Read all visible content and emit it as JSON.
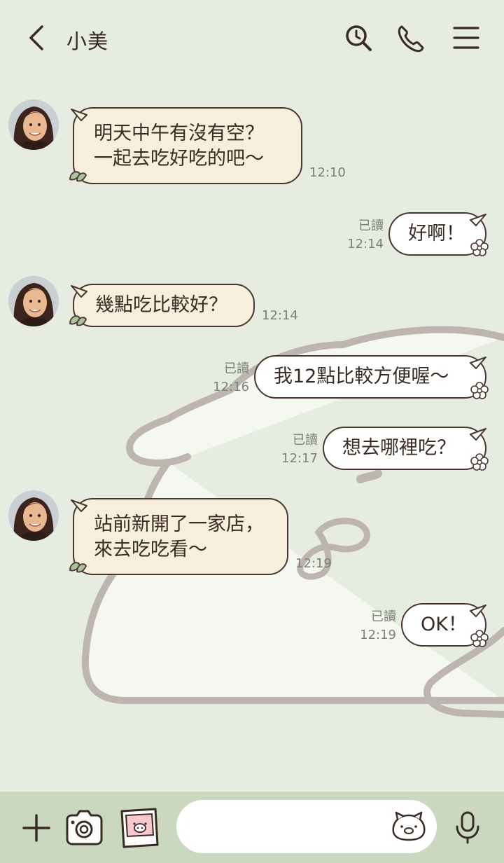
{
  "header": {
    "contact_name": "小美"
  },
  "icons": {
    "back": "chevron-left-icon",
    "search": "search-icon",
    "call": "phone-icon",
    "menu": "hamburger-menu-icon",
    "add": "plus-icon",
    "camera": "camera-icon",
    "photo": "photo-sticker-icon",
    "emoji": "emoji-icon",
    "mic": "microphone-icon"
  },
  "messages": [
    {
      "from": "friend",
      "lines": [
        "明天中午有沒有空？",
        "一起去吃好吃的吧～"
      ],
      "time": "12:10"
    },
    {
      "from": "me",
      "text": "好啊！",
      "read": "已讀",
      "time": "12:14"
    },
    {
      "from": "friend",
      "lines": [
        "幾點吃比較好？"
      ],
      "time": "12:14"
    },
    {
      "from": "me",
      "text": "我12點比較方便喔～",
      "read": "已讀",
      "time": "12:16"
    },
    {
      "from": "me",
      "text": "想去哪裡吃？",
      "read": "已讀",
      "time": "12:17"
    },
    {
      "from": "friend",
      "lines": [
        "站前新開了一家店，",
        "來去吃吃看～"
      ],
      "time": "12:19"
    },
    {
      "from": "me",
      "text": "OK！",
      "read": "已讀",
      "time": "12:19"
    }
  ],
  "input": {
    "placeholder": ""
  },
  "colors": {
    "background": "#e6ece0",
    "incoming_bubble": "#f6efdc",
    "outgoing_bubble": "#ffffff",
    "bubble_border": "#4a3530",
    "bottom_bar": "#c9d8bf",
    "leaf": "#a7c49a"
  }
}
